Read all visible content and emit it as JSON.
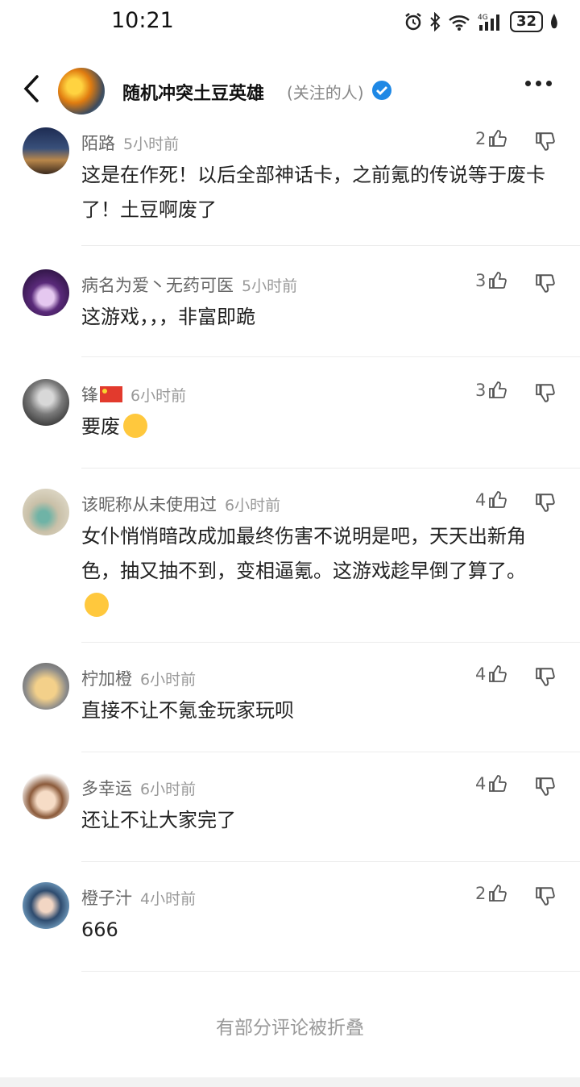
{
  "status_bar": {
    "time": "10:21",
    "battery": "32"
  },
  "header": {
    "title": "随机冲突土豆英雄",
    "tag": "(关注的人)"
  },
  "comments": [
    {
      "name": "陌路",
      "time": "5小时前",
      "likes": "2",
      "text": "这是在作死！以后全部神话卡，之前氪的传说等于废卡了！土豆啊废了"
    },
    {
      "name": "病名为爱丶无药可医",
      "time": "5小时前",
      "likes": "3",
      "text": "这游戏，，，非富即跪"
    },
    {
      "name": "锋",
      "time": "6小时前",
      "likes": "3",
      "text": "要废"
    },
    {
      "name": "该昵称从未使用过",
      "time": "6小时前",
      "likes": "4",
      "text": "女仆悄悄暗改成加最终伤害不说明是吧，天天出新角色，抽又抽不到，变相逼氪。这游戏趁早倒了算了。"
    },
    {
      "name": "柠加橙",
      "time": "6小时前",
      "likes": "4",
      "text": "直接不让不氪金玩家玩呗"
    },
    {
      "name": "多幸运",
      "time": "6小时前",
      "likes": "4",
      "text": "还让不让大家完了"
    },
    {
      "name": "橙子汁",
      "time": "4小时前",
      "likes": "2",
      "text": "666"
    }
  ],
  "folded_notice": "有部分评论被折叠",
  "icons": {
    "back": "chevron-left-icon",
    "more": "more-dots-icon",
    "like": "thumbs-up-icon",
    "dislike": "thumbs-down-icon",
    "verified": "verified-check-icon"
  }
}
